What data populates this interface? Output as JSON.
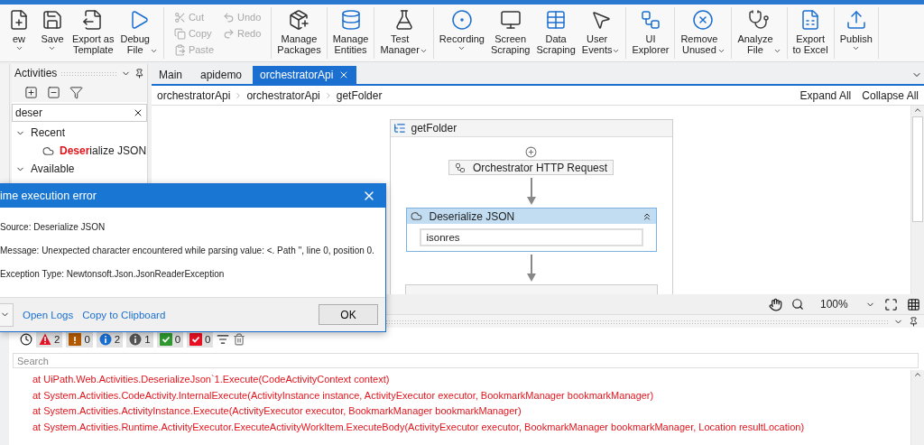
{
  "ribbon": {
    "groups": [
      {
        "items": [
          {
            "kind": "large",
            "label": "ew",
            "dropdown": true
          },
          {
            "kind": "large",
            "label": "Save",
            "dropdown": true
          },
          {
            "kind": "large",
            "label": "Export as\nTemplate",
            "dropdown": false
          },
          {
            "kind": "large",
            "label": "Debug\nFile",
            "dropdown": true
          }
        ]
      },
      {
        "items": [
          {
            "kind": "small",
            "label": "Cut",
            "disabled": true
          },
          {
            "kind": "small",
            "label": "Copy",
            "disabled": true
          },
          {
            "kind": "small",
            "label": "Paste",
            "disabled": true
          },
          {
            "kind": "small",
            "label": "Undo",
            "disabled": true
          },
          {
            "kind": "small",
            "label": "Redo",
            "disabled": true
          }
        ]
      },
      {
        "items": [
          {
            "kind": "large",
            "label": "Manage\nPackages",
            "dropdown": false
          }
        ]
      },
      {
        "items": [
          {
            "kind": "large",
            "label": "Manage\nEntities",
            "dropdown": false
          }
        ]
      },
      {
        "items": [
          {
            "kind": "large",
            "label": "Test\nManager",
            "dropdown": true
          }
        ]
      },
      {
        "items": [
          {
            "kind": "large",
            "label": "Recording",
            "dropdown": true
          },
          {
            "kind": "large",
            "label": "Screen\nScraping",
            "dropdown": false
          },
          {
            "kind": "large",
            "label": "Data\nScraping",
            "dropdown": false
          },
          {
            "kind": "large",
            "label": "User\nEvents",
            "dropdown": true
          }
        ]
      },
      {
        "items": [
          {
            "kind": "large",
            "label": "UI\nExplorer",
            "dropdown": false
          }
        ]
      },
      {
        "items": [
          {
            "kind": "large",
            "label": "Remove\nUnused",
            "dropdown": true
          }
        ]
      },
      {
        "items": [
          {
            "kind": "large",
            "label": "Analyze\nFile",
            "dropdown": true
          }
        ]
      },
      {
        "items": [
          {
            "kind": "large",
            "label": "Export\nto Excel",
            "dropdown": false
          }
        ]
      },
      {
        "items": [
          {
            "kind": "large",
            "label": "Publish",
            "dropdown": true
          }
        ]
      }
    ]
  },
  "activities": {
    "title": "Activities",
    "search": "deser",
    "tree": [
      {
        "label": "Recent",
        "expanded": true,
        "children": [
          {
            "label": "**Deser**ialize JSON"
          }
        ]
      },
      {
        "label": "Available",
        "expanded": true
      }
    ]
  },
  "tabs": [
    {
      "label": "Main",
      "selected": false
    },
    {
      "label": "apidemo",
      "selected": false
    },
    {
      "label": "orchestratorApi",
      "selected": true
    }
  ],
  "breadcrumb": [
    "orchestratorApi",
    "orchestratorApi",
    "getFolder"
  ],
  "designer_actions": [
    "Expand All",
    "Collapse All"
  ],
  "workflow": {
    "title": "getFolder",
    "activities": [
      {
        "kind": "simple",
        "title": "Orchestrator HTTP Request",
        "selected": false
      },
      {
        "kind": "expanded",
        "title": "Deserialize JSON",
        "value": "isonres",
        "selected": true
      },
      {
        "kind": "cut"
      }
    ]
  },
  "zoom": "100%",
  "output": {
    "filters": [
      {
        "kind": "error",
        "count": "2",
        "color": "#e81123"
      },
      {
        "kind": "warning",
        "count": "0",
        "color": "#b35a00"
      },
      {
        "kind": "info",
        "count": "2",
        "color": "#1a6fd1"
      },
      {
        "kind": "trace",
        "count": "1",
        "color": "#555555"
      },
      {
        "kind": "success",
        "count": "0",
        "color": "#2e9a2e"
      },
      {
        "kind": "failure",
        "count": "0",
        "color": "#e81123"
      }
    ],
    "search_placeholder": "Search",
    "lines": [
      "at UiPath.Web.Activities.DeserializeJson`1.Execute(CodeActivityContext context)",
      "at System.Activities.CodeActivity.InternalExecute(ActivityInstance instance, ActivityExecutor executor, BookmarkManager bookmarkManager)",
      "at System.Activities.ActivityInstance.Execute(ActivityExecutor executor, BookmarkManager bookmarkManager)",
      "at System.Activities.Runtime.ActivityExecutor.ExecuteActivityWorkItem.ExecuteBody(ActivityExecutor executor, BookmarkManager bookmarkManager, Location resultLocation)"
    ]
  },
  "dialog": {
    "title": "ime execution error",
    "lines": [
      "Source: Deserialize JSON",
      "Message: Unexpected character encountered while parsing value: <. Path '', line 0, position 0.",
      "Exception Type: Newtonsoft.Json.JsonReaderException"
    ],
    "links": [
      "Open Logs",
      "Copy to Clipboard"
    ],
    "button": "OK"
  }
}
